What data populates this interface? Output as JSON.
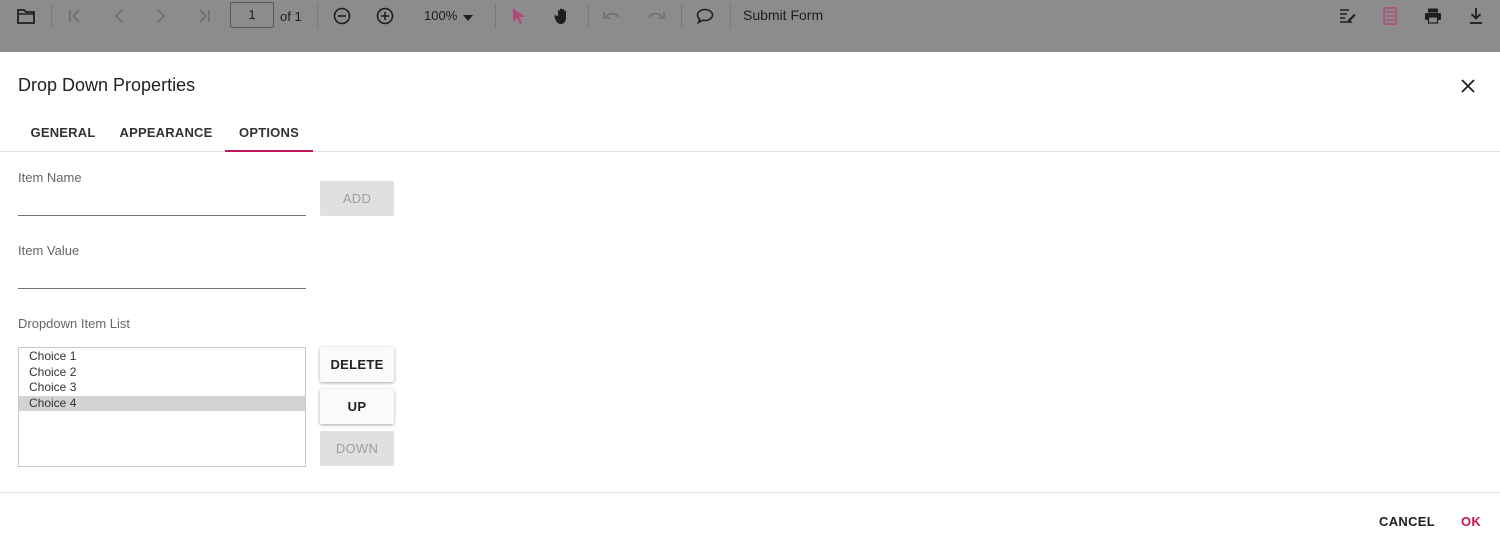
{
  "toolbar": {
    "page_number": "1",
    "page_of": "of 1",
    "zoom_level": "100%",
    "submit_form_label": "Submit Form",
    "accent_color": "#c2185b"
  },
  "dialog": {
    "title": "Drop Down Properties",
    "tabs": [
      {
        "label": "GENERAL"
      },
      {
        "label": "APPEARANCE"
      },
      {
        "label": "OPTIONS",
        "active": true
      }
    ],
    "options": {
      "item_name_label": "Item Name",
      "item_name_value": "",
      "add_label": "ADD",
      "item_value_label": "Item Value",
      "item_value_value": "",
      "list_label": "Dropdown Item List",
      "items": [
        "Choice 1",
        "Choice 2",
        "Choice 3",
        "Choice 4"
      ],
      "selected_item": "Choice 4",
      "delete_label": "DELETE",
      "up_label": "UP",
      "down_label": "DOWN"
    },
    "footer": {
      "cancel_label": "CANCEL",
      "ok_label": "OK"
    }
  }
}
